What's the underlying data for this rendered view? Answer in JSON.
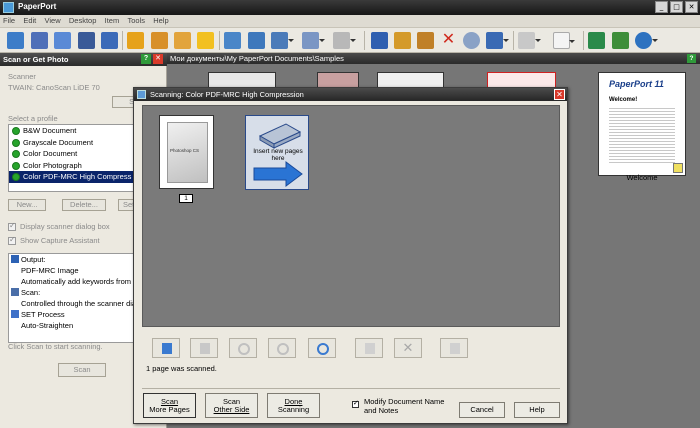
{
  "app": {
    "title": "PaperPort"
  },
  "menu": [
    "File",
    "Edit",
    "View",
    "Desktop",
    "Item",
    "Tools",
    "Help"
  ],
  "left_pane": {
    "title": "Scan or Get Photo",
    "scanner_label": "Scanner",
    "scanner_name": "TWAIN: CanoScan LiDE 70",
    "select_button": "Select",
    "profile_label": "Select a profile",
    "profiles": [
      "B&W Document",
      "Grayscale Document",
      "Color Document",
      "Color Photograph",
      "Color PDF-MRC High Compress"
    ],
    "selected_profile_index": 4,
    "new_button": "New...",
    "delete_button": "Delete...",
    "settings_button": "Set",
    "display_dialog": "Display scanner dialog box",
    "show_assistant": "Show Capture Assistant",
    "summary": {
      "output_heading": "Output:",
      "output_1": "PDF-MRC Image",
      "output_2": "Automatically add keywords from Fo",
      "scan_heading": "Scan:",
      "scan_1": "Controlled through the scanner dialo",
      "process_heading": "SET Process",
      "process_1": "Auto-Straighten"
    },
    "hint": "Click Scan to start scanning.",
    "scan_button": "Scan"
  },
  "right_pane": {
    "path": "Мои документы\\My PaperPort Documents\\Samples",
    "help_label": "?",
    "welcome_label": "Welcome",
    "welcome_doc": {
      "brand": "PaperPort 11",
      "heading": "Welcome!"
    }
  },
  "dialog": {
    "title": "Scanning: Color PDF-MRC High Compression",
    "page_number": "1",
    "page_thumb_label": "Photoshop CS",
    "insert_text": "Insert new pages here",
    "status": "1 page was scanned.",
    "buttons": {
      "scan_more_1": "Scan",
      "scan_more_2": "More Pages",
      "scan_other_1": "Scan",
      "scan_other_2": "Other Side",
      "done_1": "Done",
      "done_2": "Scanning",
      "cancel": "Cancel",
      "help": "Help"
    },
    "modify_label_1": "Modify Document Name",
    "modify_label_2": "and Notes",
    "modify_checked": true
  },
  "colors": {
    "title_bg": "#262626",
    "selection": "#0a246a",
    "profile_dot": "#27a42c",
    "close_red": "#d9392b",
    "viewer_gray": "#7a7a7a"
  }
}
